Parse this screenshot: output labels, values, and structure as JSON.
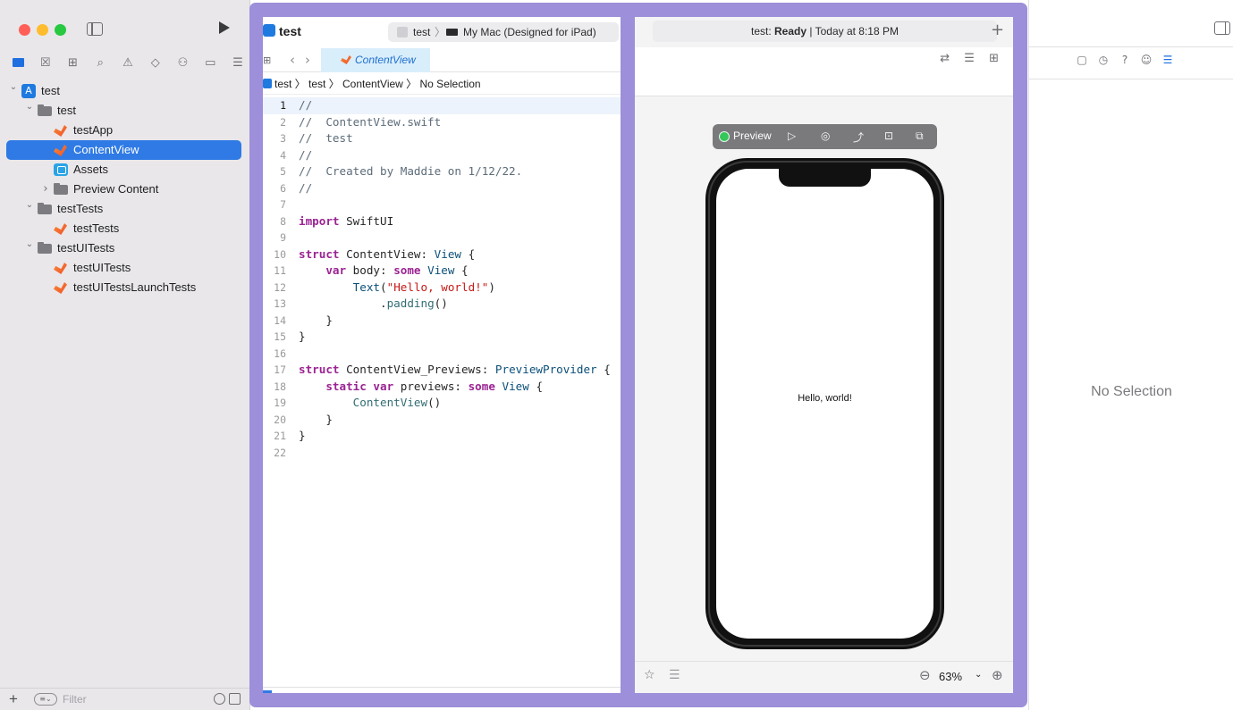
{
  "window": {
    "traffic_lights": {
      "close": "#ff5f57",
      "minimize": "#febc2e",
      "zoom": "#28c840"
    }
  },
  "navigator": {
    "tabs": [
      {
        "name": "project-navigator",
        "icon": "folder-icon",
        "glyph": "",
        "active": true
      },
      {
        "name": "source-control",
        "icon": "source-control-icon",
        "glyph": "☒"
      },
      {
        "name": "symbols",
        "icon": "symbol-icon",
        "glyph": "⊞"
      },
      {
        "name": "find",
        "icon": "search-icon",
        "glyph": "⌕"
      },
      {
        "name": "issues",
        "icon": "warning-icon",
        "glyph": "⚠"
      },
      {
        "name": "tests",
        "icon": "diamond-icon",
        "glyph": "◇"
      },
      {
        "name": "debug",
        "icon": "debug-icon",
        "glyph": "⚇"
      },
      {
        "name": "breakpoints",
        "icon": "breakpoint-icon",
        "glyph": "▭"
      },
      {
        "name": "reports",
        "icon": "report-icon",
        "glyph": "☰"
      }
    ],
    "tree": [
      {
        "label": "test",
        "icon": "app",
        "indent": 0,
        "chevron": "open"
      },
      {
        "label": "test",
        "icon": "folder",
        "indent": 1,
        "chevron": "open"
      },
      {
        "label": "testApp",
        "icon": "swift",
        "indent": 2
      },
      {
        "label": "ContentView",
        "icon": "swift",
        "indent": 2,
        "selected": true
      },
      {
        "label": "Assets",
        "icon": "assets",
        "indent": 2
      },
      {
        "label": "Preview Content",
        "icon": "folder",
        "indent": 2,
        "chevron": "closed"
      },
      {
        "label": "testTests",
        "icon": "folder",
        "indent": 1,
        "chevron": "open"
      },
      {
        "label": "testTests",
        "icon": "swift",
        "indent": 2
      },
      {
        "label": "testUITests",
        "icon": "folder",
        "indent": 1,
        "chevron": "open"
      },
      {
        "label": "testUITests",
        "icon": "swift",
        "indent": 2
      },
      {
        "label": "testUITestsLaunchTests",
        "icon": "swift",
        "indent": 2
      }
    ],
    "filter": {
      "placeholder": "Filter"
    }
  },
  "toolbar": {
    "project_title": "test",
    "scheme": "test",
    "scheme_separator": "〉",
    "destination": "My Mac (Designed for iPad)",
    "activity_prefix": "test: ",
    "activity_status": "Ready",
    "activity_suffix": " | Today at 8:18 PM",
    "add_tab": "+"
  },
  "editor": {
    "tab_label": "ContentView",
    "breadcrumb": "test 〉 test 〉 ContentView 〉 No Selection",
    "current_line": 1,
    "lines": [
      {
        "n": "1",
        "type": "comment",
        "text": "//"
      },
      {
        "n": "2",
        "type": "comment",
        "text": "//  ContentView.swift"
      },
      {
        "n": "3",
        "type": "comment",
        "text": "//  test"
      },
      {
        "n": "4",
        "type": "comment",
        "text": "//"
      },
      {
        "n": "5",
        "type": "comment",
        "text": "//  Created by Maddie on 1/12/22."
      },
      {
        "n": "6",
        "type": "comment",
        "text": "//"
      },
      {
        "n": "7",
        "type": "plain",
        "text": ""
      },
      {
        "n": "8",
        "type": "import",
        "kw": "import",
        "rest": " SwiftUI"
      },
      {
        "n": "9",
        "type": "plain",
        "text": ""
      },
      {
        "n": "10",
        "type": "struct",
        "kw": "struct",
        "name": " ContentView",
        "mid": ": ",
        "proto": "View",
        "tail": " {"
      },
      {
        "n": "11",
        "type": "var",
        "indent": "    ",
        "kw": "var",
        "name": " body",
        "mid": ": ",
        "kw2": "some",
        "proto": " View",
        "tail": " {"
      },
      {
        "n": "12",
        "type": "call",
        "indent": "        ",
        "fn": "Text",
        "open": "(",
        "str": "\"Hello, world!\"",
        "close": ")"
      },
      {
        "n": "13",
        "type": "method",
        "indent": "            ",
        "dot": ".",
        "fn": "padding",
        "tail": "()"
      },
      {
        "n": "14",
        "type": "plain",
        "text": "    }"
      },
      {
        "n": "15",
        "type": "plain",
        "text": "}"
      },
      {
        "n": "16",
        "type": "plain",
        "text": ""
      },
      {
        "n": "17",
        "type": "struct",
        "kw": "struct",
        "name": " ContentView_Previews",
        "mid": ": ",
        "proto": "PreviewProvider",
        "tail": " {"
      },
      {
        "n": "18",
        "type": "staticvar",
        "indent": "    ",
        "kw": "static var",
        "name": " previews",
        "mid": ": ",
        "kw2": "some",
        "proto": " View",
        "tail": " {"
      },
      {
        "n": "19",
        "type": "call2",
        "indent": "        ",
        "fn": "ContentView",
        "tail": "()"
      },
      {
        "n": "20",
        "type": "plain",
        "text": "    }"
      },
      {
        "n": "21",
        "type": "plain",
        "text": "}"
      },
      {
        "n": "22",
        "type": "plain",
        "text": ""
      }
    ]
  },
  "canvas": {
    "preview_label": "Preview",
    "preview_icons": [
      "▷",
      "◎",
      "⤴",
      "⊡",
      "⧉"
    ],
    "device_text": "Hello, world!",
    "zoom_level": "63%",
    "zoom_out": "⊖",
    "zoom_in": "⊕",
    "zoom_chevron": "⌄",
    "pin_glyph": "☆",
    "variants_glyph": "☰",
    "header_icons": "⇄ ☰ ⊞"
  },
  "inspector": {
    "tabs": [
      {
        "name": "file-inspector",
        "icon": "document-icon",
        "glyph": "▢"
      },
      {
        "name": "history-inspector",
        "icon": "clock-icon",
        "glyph": "◷"
      },
      {
        "name": "quick-help",
        "icon": "help-icon",
        "glyph": "?"
      },
      {
        "name": "accessibility",
        "icon": "accessibility-icon",
        "glyph": "☺"
      },
      {
        "name": "attributes-inspector",
        "icon": "sliders-icon",
        "glyph": "☰",
        "active": true
      }
    ],
    "empty_message": "No Selection"
  },
  "colors": {
    "highlight_frame": "#9d8fd9",
    "selection": "#2f7ae5",
    "accent": "#1f6fe0"
  }
}
